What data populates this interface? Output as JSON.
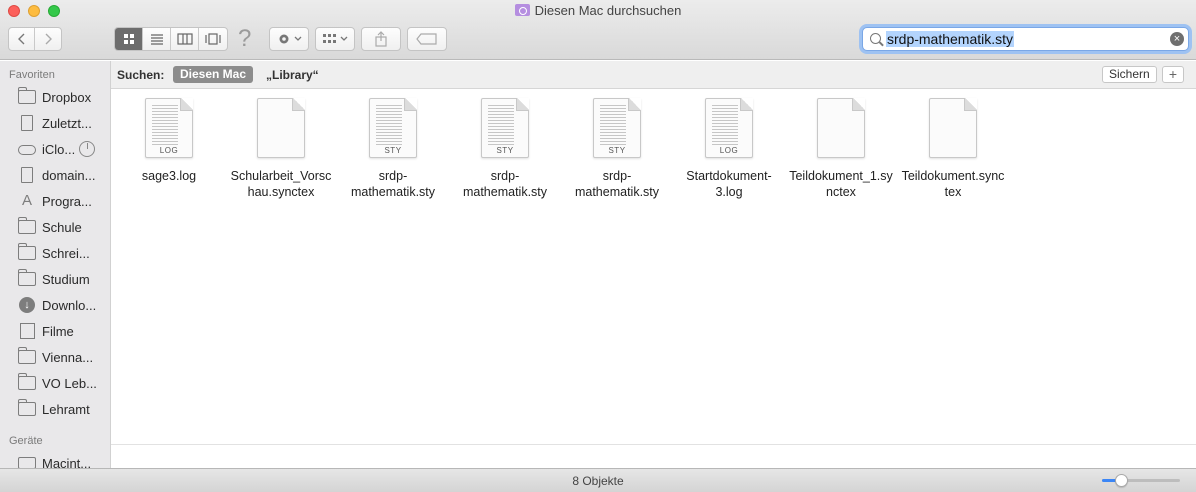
{
  "window": {
    "title": "Diesen Mac durchsuchen"
  },
  "toolbar": {
    "back_icon": "chevron-left-icon",
    "forward_icon": "chevron-right-icon",
    "help_glyph": "?",
    "search_value": "srdp-mathematik.sty"
  },
  "sidebar": {
    "favorites_header": "Favoriten",
    "items": [
      {
        "label": "Dropbox",
        "icon": "folder-icon"
      },
      {
        "label": "Zuletzt...",
        "icon": "document-icon"
      },
      {
        "label": "iClo...",
        "icon": "cloud-icon"
      },
      {
        "label": "domain...",
        "icon": "document-icon"
      },
      {
        "label": "Progra...",
        "icon": "applications-icon"
      },
      {
        "label": "Schule",
        "icon": "folder-icon"
      },
      {
        "label": "Schrei...",
        "icon": "folder-icon"
      },
      {
        "label": "Studium",
        "icon": "folder-icon"
      },
      {
        "label": "Downlo...",
        "icon": "download-icon"
      },
      {
        "label": "Filme",
        "icon": "film-icon"
      },
      {
        "label": "Vienna...",
        "icon": "folder-icon"
      },
      {
        "label": "VO Leb...",
        "icon": "folder-icon"
      },
      {
        "label": "Lehramt",
        "icon": "folder-icon"
      }
    ],
    "devices_header": "Geräte",
    "devices": [
      {
        "label": "Macint...",
        "icon": "disk-icon"
      }
    ]
  },
  "scope": {
    "label": "Suchen:",
    "active": "Diesen Mac",
    "other": "„Library“",
    "save": "Sichern",
    "add": "+"
  },
  "files": [
    {
      "name": "sage3.log",
      "tag": "LOG",
      "lines": true
    },
    {
      "name": "Schularbeit_Vorschau.synctex",
      "tag": "",
      "lines": false
    },
    {
      "name": "srdp-mathematik.sty",
      "tag": "STY",
      "lines": true
    },
    {
      "name": "srdp-mathematik.sty",
      "tag": "STY",
      "lines": true
    },
    {
      "name": "srdp-mathematik.sty",
      "tag": "STY",
      "lines": true
    },
    {
      "name": "Startdokument-3.log",
      "tag": "LOG",
      "lines": true
    },
    {
      "name": "Teildokument_1.synctex",
      "tag": "",
      "lines": false
    },
    {
      "name": "Teildokument.synctex",
      "tag": "",
      "lines": false
    }
  ],
  "status": {
    "text": "8 Objekte",
    "icon_size_level": 0.24
  },
  "colors": {
    "selection": "#b3d4fd",
    "accent": "#3b86f6",
    "scope_active": "#8c8c8c"
  }
}
